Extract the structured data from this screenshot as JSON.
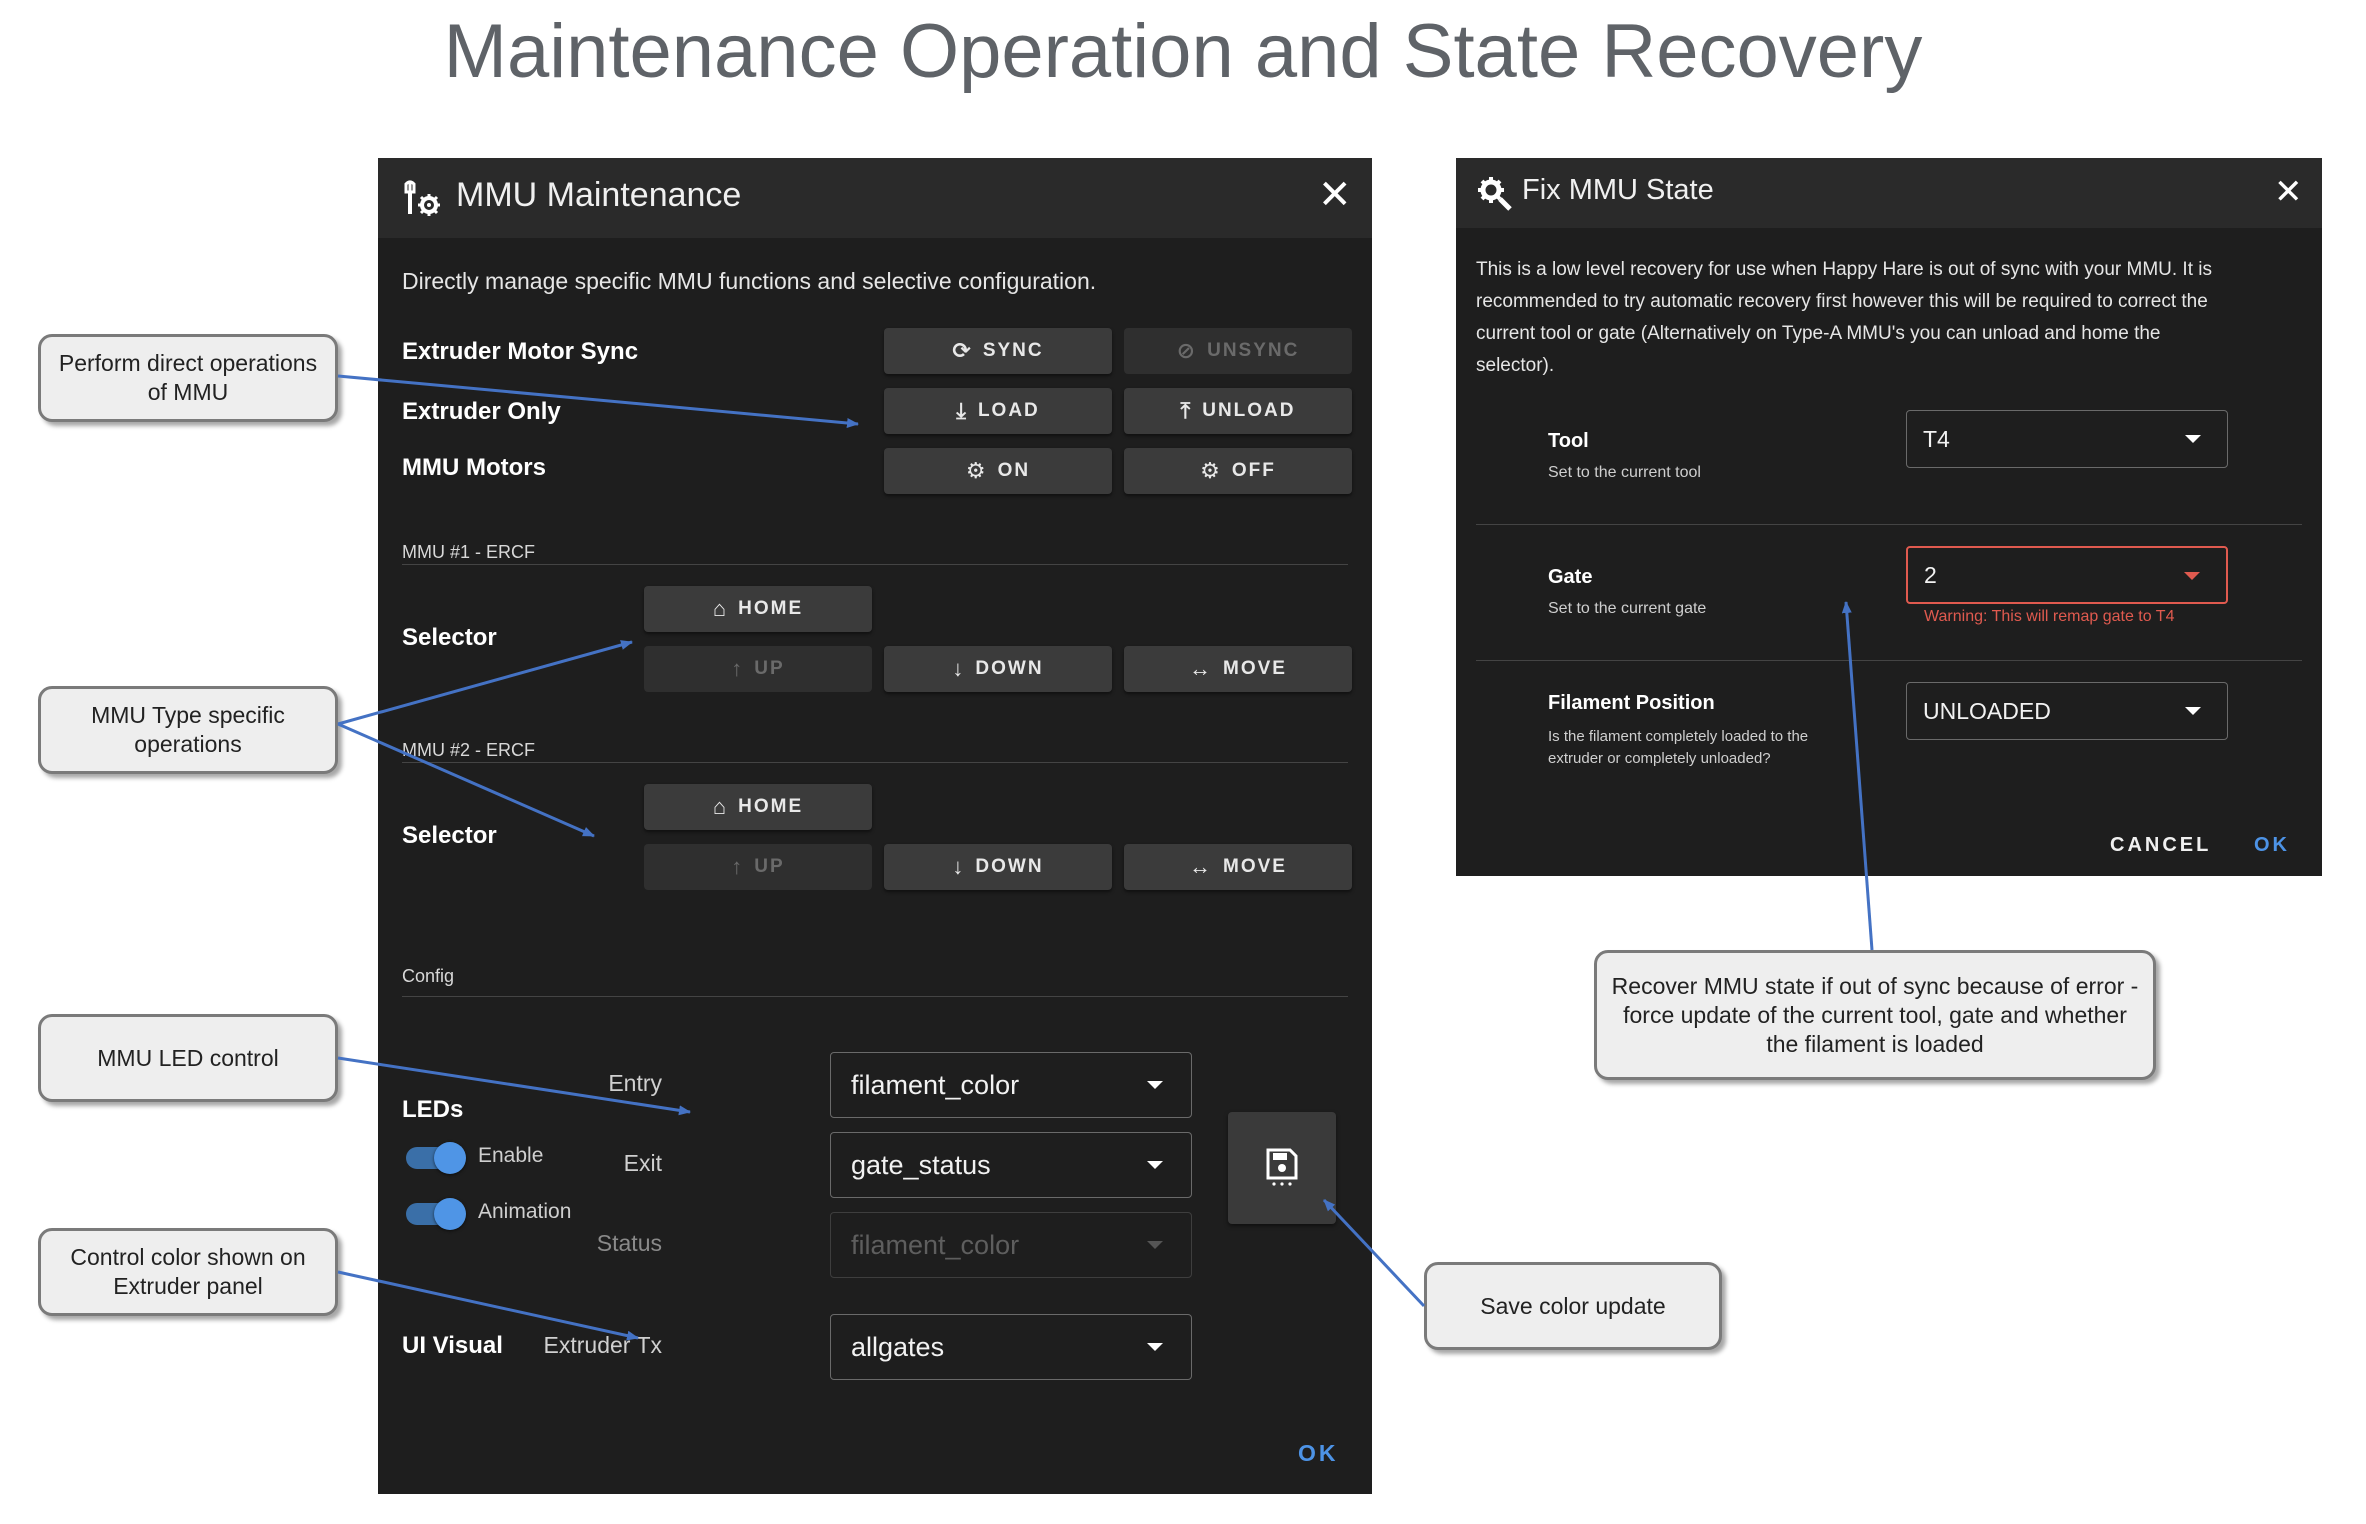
{
  "page_title": "Maintenance Operation and State Recovery",
  "maintenance": {
    "title": "MMU Maintenance",
    "header_icon": "wrench-gear-icon",
    "close_icon": "close-icon",
    "description": "Directly manage specific MMU functions and selective configuration.",
    "rows": {
      "sync_label": "Extruder Motor Sync",
      "extruder_label": "Extruder Only",
      "motors_label": "MMU Motors"
    },
    "buttons": {
      "sync": "SYNC",
      "unsync": "UNSYNC",
      "load": "LOAD",
      "unload": "UNLOAD",
      "on": "ON",
      "off": "OFF",
      "home": "HOME",
      "up": "UP",
      "down": "DOWN",
      "move": "MOVE"
    },
    "mmu1": {
      "section": "MMU #1 - ERCF",
      "selector_label": "Selector"
    },
    "mmu2": {
      "section": "MMU #2 - ERCF",
      "selector_label": "Selector"
    },
    "config": {
      "section": "Config",
      "leds_label": "LEDs",
      "enable_label": "Enable",
      "enable_on": true,
      "animation_label": "Animation",
      "animation_on": true,
      "entry_label": "Entry",
      "entry_value": "filament_color",
      "exit_label": "Exit",
      "exit_value": "gate_status",
      "status_label": "Status",
      "status_value": "filament_color",
      "ui_visual_label": "UI Visual",
      "extruder_tx_label": "Extruder Tx",
      "extruder_tx_value": "allgates"
    },
    "ok": "OK"
  },
  "fix_state": {
    "title": "Fix MMU State",
    "header_icon": "gear-wrench-icon",
    "close_icon": "close-icon",
    "description_lines": [
      "This is a low level recovery for use when Happy Hare is out of sync with your MMU. It is",
      "recommended to try automatic recovery first however this will be required to correct the",
      "current tool or gate (Alternatively on Type-A MMU's you can unload and home the",
      "selector)."
    ],
    "tool_label": "Tool",
    "tool_help": "Set to the current tool",
    "tool_value": "T4",
    "gate_label": "Gate",
    "gate_help": "Set to the current gate",
    "gate_value": "2",
    "gate_warning": "Warning: This will remap gate to T4",
    "filament_label": "Filament Position",
    "filament_help_lines": [
      "Is the filament completely loaded to the",
      "extruder or completely unloaded?"
    ],
    "filament_value": "UNLOADED",
    "cancel": "CANCEL",
    "ok": "OK"
  },
  "callouts": {
    "direct_ops": [
      "Perform direct operations",
      "of MMU"
    ],
    "type_specific": [
      "MMU Type specific",
      "operations"
    ],
    "led_control": [
      "MMU LED control"
    ],
    "color_control": [
      "Control color shown on",
      "Extruder panel"
    ],
    "save_color": [
      "Save color update"
    ],
    "recover": [
      "Recover MMU state if out of sync because of error -",
      "force update of the current tool, gate and whether",
      "the filament is loaded"
    ]
  },
  "colors": {
    "dialog_bg": "#1e1e1e",
    "header_bg": "#2a2a2a",
    "accent_blue": "#4d93e6",
    "warning_red": "#e05a4f",
    "arrow_blue": "#4472c4",
    "callout_bg": "#eeeeee"
  }
}
